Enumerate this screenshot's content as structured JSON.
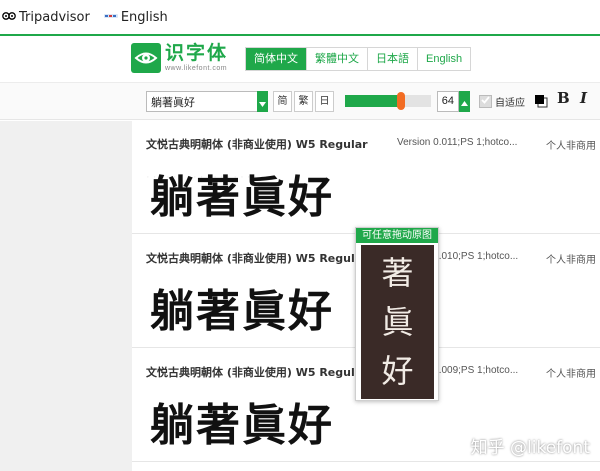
{
  "bookmarks": [
    {
      "icon": "tripadvisor-owl-icon",
      "label": "Tripadvisor"
    },
    {
      "icon": "ekrmb-globe-icon",
      "label": "English"
    }
  ],
  "site": {
    "logo_title": "识字体",
    "logo_url": "www.likefont.com",
    "lang_tabs": [
      {
        "label": "简体中文",
        "active": true
      },
      {
        "label": "繁體中文",
        "active": false
      },
      {
        "label": "日本語",
        "active": false
      },
      {
        "label": "English",
        "active": false
      }
    ]
  },
  "toolbar": {
    "sample_text": "躺著眞好",
    "script_buttons": [
      "简",
      "繁",
      "日"
    ],
    "font_size": "64",
    "size_level_percent": 65,
    "adaptive_label": "自适应",
    "adaptive_checked": true,
    "bold_label": "B",
    "italic_label": "I"
  },
  "fonts": [
    {
      "name": "文悦古典明朝体 (非商业使用) W5 Regular",
      "version": "Version 0.011;PS 1;hotco...",
      "license": "个人非商用",
      "sample": "躺著眞好"
    },
    {
      "name": "文悦古典明朝体 (非商业使用) W5 Regular",
      "version": "Version 0.010;PS 1;hotco...",
      "license": "个人非商用",
      "sample": "躺著眞好"
    },
    {
      "name": "文悦古典明朝体 (非商业使用) W5 Regular",
      "version": "Version 0.009;PS 1;hotco...",
      "license": "个人非商用",
      "sample": "躺著眞好"
    }
  ],
  "drag_preview": {
    "title": "可任意拖动原图",
    "chars": [
      "著",
      "眞",
      "好"
    ]
  },
  "platform_watermark": "知乎 @likefont",
  "colors": {
    "brand_green": "#1fa84a",
    "slider_thumb": "#f26c23",
    "preview_bg": "#3a2a27"
  }
}
